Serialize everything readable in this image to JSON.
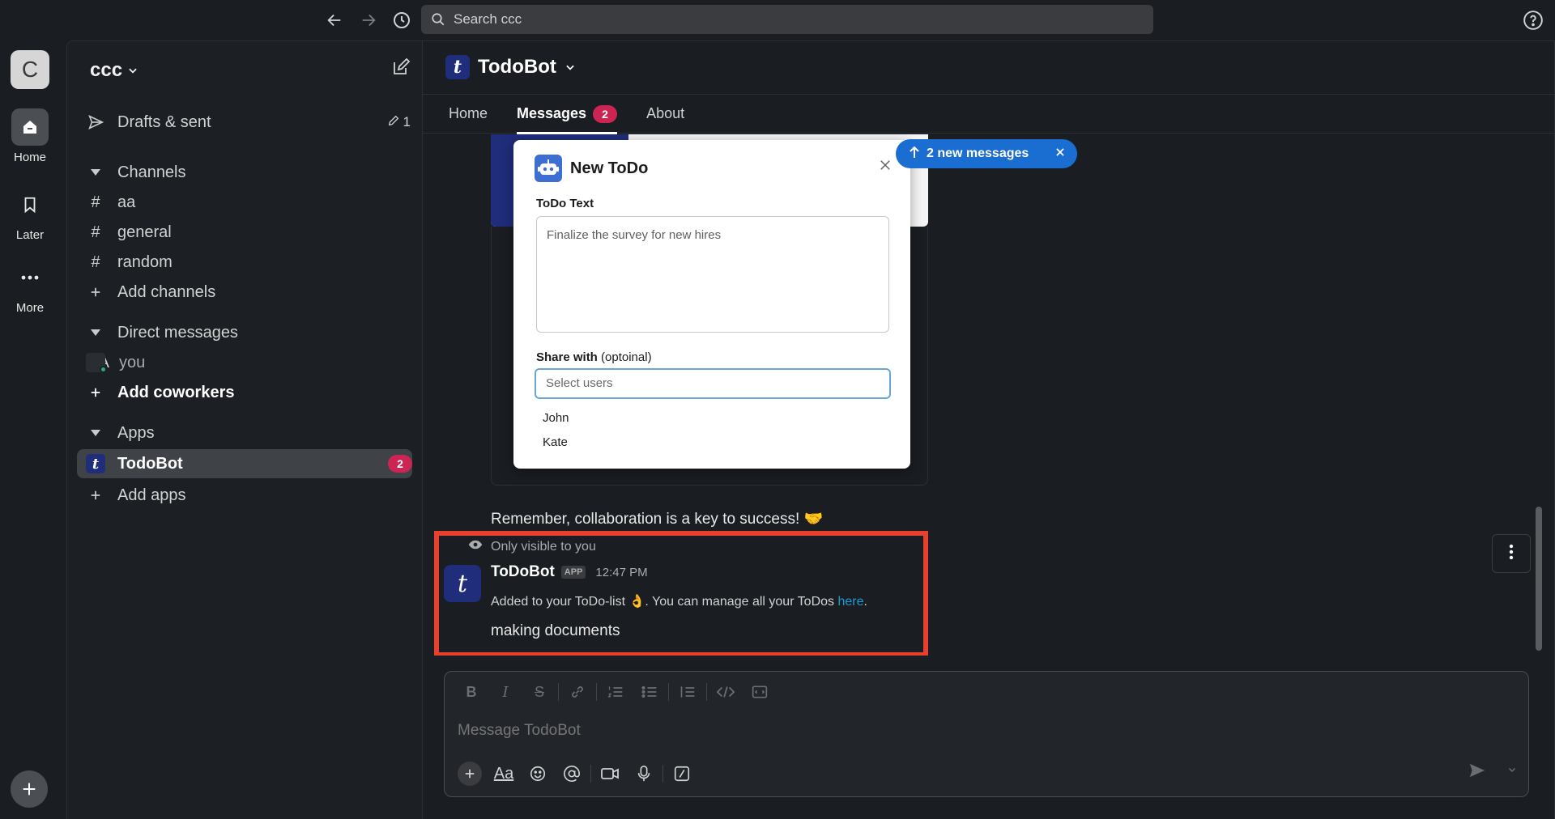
{
  "topbar": {
    "search_placeholder": "Search ccc"
  },
  "rail": {
    "workspace_initial": "C",
    "items": [
      {
        "label": "Home",
        "icon": "home-icon"
      },
      {
        "label": "Later",
        "icon": "bookmark-icon"
      },
      {
        "label": "More",
        "icon": "more-icon"
      }
    ]
  },
  "sidebar": {
    "workspace_name": "ccc",
    "drafts": {
      "label": "Drafts & sent",
      "count": "1"
    },
    "channels_header": "Channels",
    "channels": [
      "aa",
      "general",
      "random"
    ],
    "add_channels": "Add channels",
    "dm_header": "Direct messages",
    "dm": {
      "initials": "MA",
      "name": "you"
    },
    "add_coworkers": "Add coworkers",
    "apps_header": "Apps",
    "app": {
      "name": "TodoBot",
      "badge": "2",
      "logo": "t"
    },
    "add_apps": "Add apps"
  },
  "channel": {
    "title": "TodoBot",
    "tabs": [
      {
        "label": "Home"
      },
      {
        "label": "Messages",
        "count": "2"
      },
      {
        "label": "About"
      }
    ]
  },
  "modal": {
    "title": "New ToDo",
    "todo_label": "ToDo Text",
    "todo_value": "Finalize the survey for new hires",
    "share_label": "Share with",
    "share_hint": "(optoinal)",
    "select_placeholder": "Select users",
    "options": [
      "John",
      "Kate"
    ]
  },
  "new_messages_pill": "2 new messages",
  "messages": {
    "collab_line": "Remember, collaboration is a key to success! 🤝",
    "visibility_note": "Only visible to you",
    "author": "ToDoBot",
    "app_tag": "APP",
    "time": "12:47 PM",
    "body_prefix": "Added to your ToDo-list 👌. You can manage all your ToDos ",
    "body_link": "here",
    "body_suffix": ".",
    "item": "making documents"
  },
  "composer": {
    "placeholder": "Message TodoBot",
    "aa_label": "Aa"
  },
  "colors": {
    "accent_badge": "#cd2553",
    "link": "#1d9bd1",
    "highlight": "#e8402f",
    "pill": "#1b6ed1"
  }
}
